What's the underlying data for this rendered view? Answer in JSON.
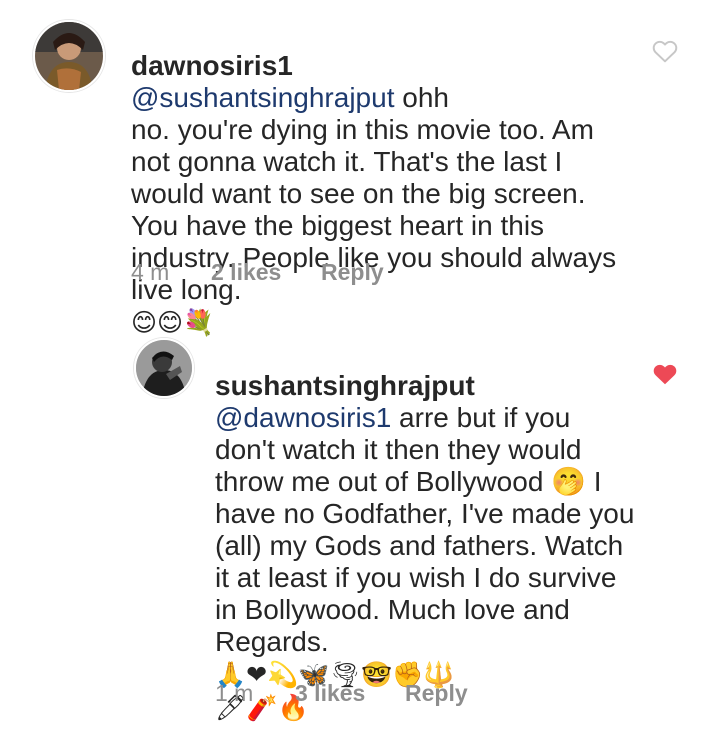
{
  "comments": [
    {
      "username": "dawnosiris1",
      "mention": "@sushantsinghrajput",
      "text": " ohh\nno. you're dying in this movie too. Am\nnot gonna watch it. That's the last I\nwould want to see on the big screen.\nYou have the biggest heart in this\nindustry. People like you should always\nlive long.",
      "emojis": "😊😊💐",
      "time": "4 m",
      "likes": "2 likes",
      "reply": "Reply",
      "liked": false,
      "heart_color": "#c7c7c7"
    },
    {
      "username": "sushantsinghrajput",
      "mention": "@dawnosiris1",
      "text": " arre but if you\ndon't watch it then they would\nthrow me out of Bollywood 🤭 I\nhave no Godfather, I've made you\n(all) my Gods and fathers. Watch\nit at least if you wish I do survive\nin Bollywood. Much love and\nRegards.",
      "emojis": "🙏❤💫🦋🌪🤓✊🔱\n🖊🧨🔥",
      "time": "1 m",
      "likes": "3 likes",
      "reply": "Reply",
      "liked": true,
      "heart_color": "#ed4956"
    }
  ]
}
